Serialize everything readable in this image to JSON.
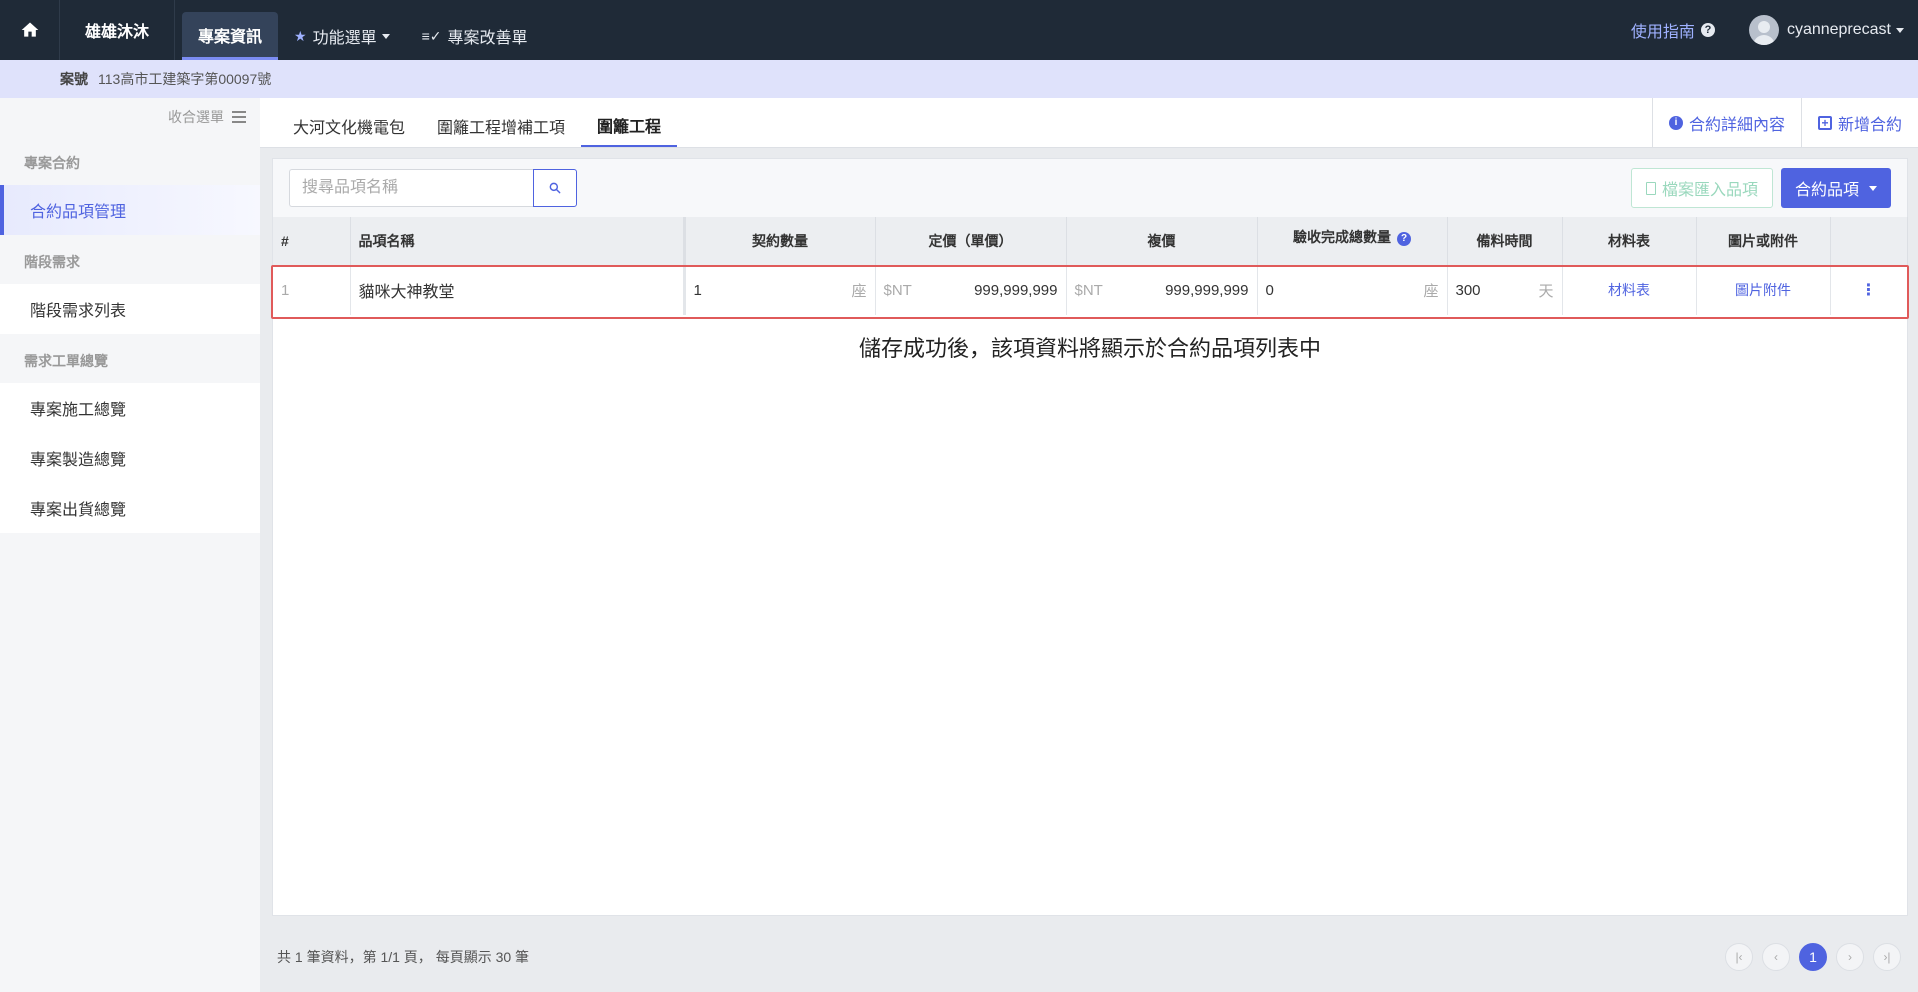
{
  "topbar": {
    "brand": "雄雄沐沐",
    "nav": [
      {
        "label": "專案資訊",
        "icon": "",
        "active": true
      },
      {
        "label": "功能選單",
        "icon": "★",
        "dropdown": true
      },
      {
        "label": "專案改善單",
        "icon": "≡✓"
      }
    ],
    "guide_label": "使用指南",
    "username": "cyanneprecast"
  },
  "casebar": {
    "label": "案號",
    "value": "113高市工建築字第00097號"
  },
  "sidebar": {
    "collapse_label": "收合選單",
    "groups": [
      {
        "title": "專案合約",
        "items": [
          {
            "label": "合約品項管理",
            "active": true
          }
        ]
      },
      {
        "title": "階段需求",
        "items": [
          {
            "label": "階段需求列表"
          }
        ]
      },
      {
        "title": "需求工單總覽",
        "items": [
          {
            "label": "專案施工總覽"
          },
          {
            "label": "專案製造總覽"
          },
          {
            "label": "專案出貨總覽"
          }
        ]
      }
    ]
  },
  "tabs": [
    {
      "label": "大河文化機電包"
    },
    {
      "label": "圍籬工程增補工項"
    },
    {
      "label": "圍籬工程",
      "active": true
    }
  ],
  "tab_actions": {
    "details": "合約詳細內容",
    "new_contract": "新增合約"
  },
  "toolbar": {
    "search_placeholder": "搜尋品項名稱",
    "import_label": "檔案匯入品項",
    "items_label": "合約品項"
  },
  "table": {
    "headers": [
      "#",
      "品項名稱",
      "契約數量",
      "定價（單價）",
      "複價",
      "驗收完成總數量",
      "備料時間",
      "材料表",
      "圖片或附件"
    ],
    "rows": [
      {
        "index": "1",
        "name": "貓咪大神教堂",
        "qty": "1",
        "qty_unit": "座",
        "price_prefix": "$NT",
        "price": "999,999,999",
        "total_prefix": "$NT",
        "total": "999,999,999",
        "accepted": "0",
        "accepted_unit": "座",
        "prep_time": "300",
        "prep_unit": "天",
        "materials": "材料表",
        "attachments": "圖片附件"
      }
    ]
  },
  "notice": "儲存成功後，該項資料將顯示於合約品項列表中",
  "footer": {
    "summary": "共 1 筆資料，第 1/1 頁， 每頁顯示 30 筆",
    "current_page": "1"
  },
  "colors": {
    "accent": "#4f63e0",
    "topbar": "#1f2a37",
    "highlight": "#e05a5a"
  }
}
